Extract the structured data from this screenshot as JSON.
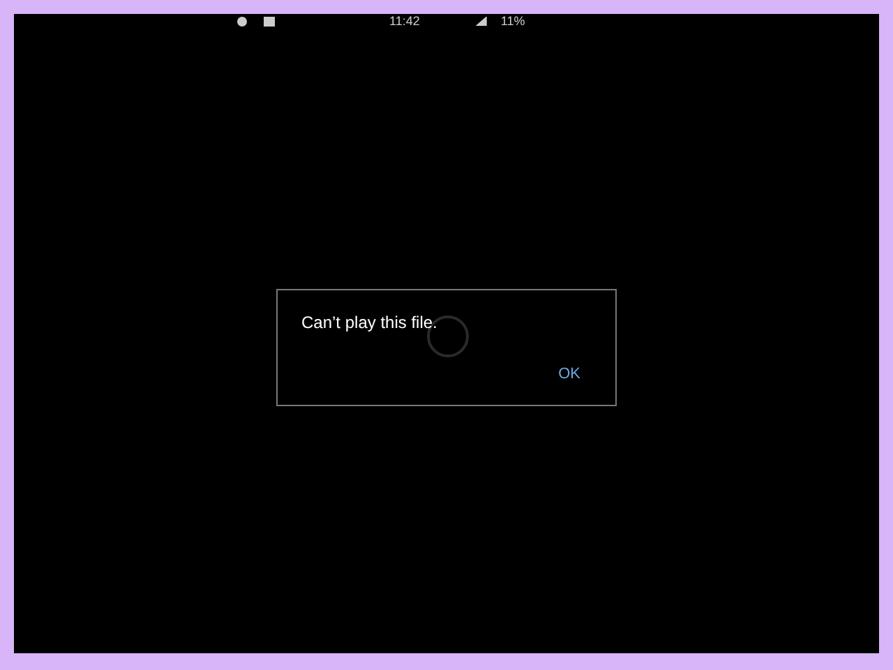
{
  "status_bar": {
    "time": "11:42",
    "battery": "11%"
  },
  "dialog": {
    "message": "Can’t play this file.",
    "buttons": [
      "OK"
    ]
  }
}
